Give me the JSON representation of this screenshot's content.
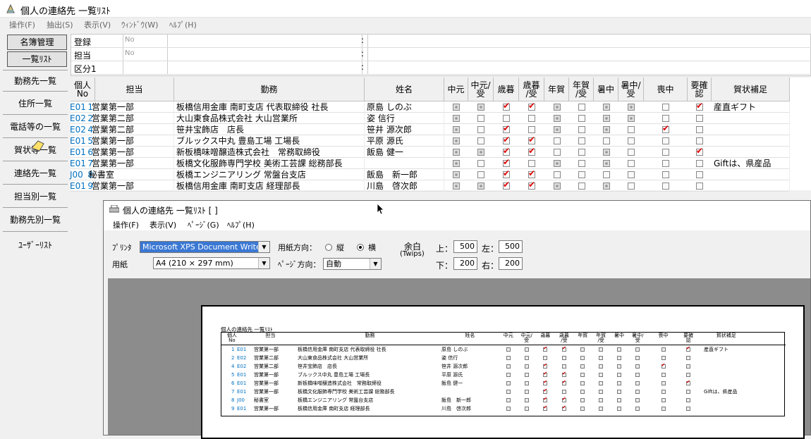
{
  "window": {
    "title": "個人の連絡先 一覧ﾘｽﾄ"
  },
  "menu": [
    "操作(F)",
    "抽出(S)",
    "表示(V)",
    "ｳｨﾝﾄﾞｳ(W)",
    "ﾍﾙﾌﾟ(H)"
  ],
  "sidebar": {
    "buttons": [
      "名簿管理",
      "一覧ﾘｽﾄ"
    ],
    "items": [
      "勤務先一覧",
      "住所一覧",
      "電話等の一覧",
      "賀状等一覧",
      "連絡先一覧",
      "担当別一覧",
      "勤務先別一覧",
      "ﾕｰｻﾞｰﾘｽﾄ"
    ]
  },
  "filter": {
    "rows": [
      {
        "label": "登録",
        "value": "No"
      },
      {
        "label": "担当",
        "value": "No"
      },
      {
        "label": "区分1",
        "value": ""
      }
    ],
    "colon": ":"
  },
  "grid": {
    "headers": [
      "個人\nNo",
      "担当",
      "勤務",
      "姓名",
      "中元",
      "中元/\n受",
      "歳暮",
      "歳暮\n/受",
      "年賀",
      "年賀\n/受",
      "暑中",
      "暑中/\n受",
      "喪中",
      "要確\n認",
      "賀状補足"
    ],
    "rows": [
      {
        "no": "1",
        "code": "E01",
        "tanto": "営業第一部",
        "kinmu": "板橋信用金庫 南町支店 代表取締役 社長",
        "name": "原島 しのぶ",
        "flags": [
          "d",
          "d",
          "c",
          "c",
          "d",
          "n",
          "d",
          "d",
          "n",
          "c"
        ],
        "note": "産直ギフト"
      },
      {
        "no": "2",
        "code": "E02",
        "tanto": "営業第二部",
        "kinmu": "大山東食品株式会社 大山営業所",
        "name": "姿 信行",
        "flags": [
          "d",
          "n",
          "n",
          "n",
          "d",
          "n",
          "d",
          "d",
          "n",
          "n"
        ],
        "note": ""
      },
      {
        "no": "4",
        "code": "E02",
        "tanto": "営業第二部",
        "kinmu": "笹井宝飾店　店長",
        "name": "笹井 源次郎",
        "flags": [
          "d",
          "n",
          "c",
          "n",
          "d",
          "n",
          "d",
          "n",
          "c",
          "n"
        ],
        "note": ""
      },
      {
        "no": "5",
        "code": "E01",
        "tanto": "営業第一部",
        "kinmu": "ブルックス中丸 豊島工場 工場長",
        "name": "平原 源氏",
        "flags": [
          "d",
          "n",
          "c",
          "c",
          "n",
          "n",
          "n",
          "n",
          "n",
          "n"
        ],
        "note": ""
      },
      {
        "no": "6",
        "code": "E01",
        "tanto": "営業第一部",
        "kinmu": "新板橋味噌醸造株式会社　常務取締役",
        "name": "飯島 健一",
        "flags": [
          "d",
          "d",
          "c",
          "c",
          "n",
          "n",
          "d",
          "n",
          "n",
          "c"
        ],
        "note": ""
      },
      {
        "no": "7",
        "code": "E01",
        "tanto": "営業第一部",
        "kinmu": "板橋文化服飾専門学校 美術工芸課 総務部長",
        "name": "",
        "flags": [
          "d",
          "n",
          "c",
          "n",
          "d",
          "n",
          "d",
          "n",
          "n",
          "n"
        ],
        "note": "Giftは、県産品"
      },
      {
        "no": "8",
        "code": "J00",
        "tanto": "秘書室",
        "kinmu": "板橋エンジニアリング 常盤台支店",
        "name": "飯島　新一郎",
        "flags": [
          "d",
          "n",
          "c",
          "c",
          "n",
          "n",
          "n",
          "n",
          "n",
          "n"
        ],
        "note": ""
      },
      {
        "no": "9",
        "code": "E01",
        "tanto": "営業第一部",
        "kinmu": "板橋信用金庫 南町支店 経理部長",
        "name": "川島　啓次郎",
        "flags": [
          "d",
          "d",
          "c",
          "c",
          "d",
          "n",
          "d",
          "n",
          "n",
          "n"
        ],
        "note": ""
      }
    ]
  },
  "print_window": {
    "title": "個人の連絡先 一覧ﾘｽﾄ [ ]",
    "menu": [
      "操作(F)",
      "表示(V)",
      "ﾍﾟｰｼﾞ(G)",
      "ﾍﾙﾌﾟ(H)"
    ],
    "printer_label": "ﾌﾟﾘﾝﾀ",
    "printer_value": "Microsoft XPS Document Writer",
    "paper_label": "用紙",
    "paper_value": "A4 (210 × 297 mm)",
    "orientation_label": "用紙方向：",
    "orientation_portrait": "縦",
    "orientation_landscape": "横",
    "page_dir_label": "ﾍﾟｰｼﾞ方向：",
    "page_dir_value": "自動",
    "margin_label": "余白",
    "margin_unit": "(Twips)",
    "top_label": "上：",
    "top_value": "500",
    "left_label": "左：",
    "left_value": "500",
    "bottom_label": "下：",
    "bottom_value": "200",
    "right_label": "右：",
    "right_value": "200",
    "preview_title": "個人の連絡先 一覧ﾘｽﾄ"
  }
}
